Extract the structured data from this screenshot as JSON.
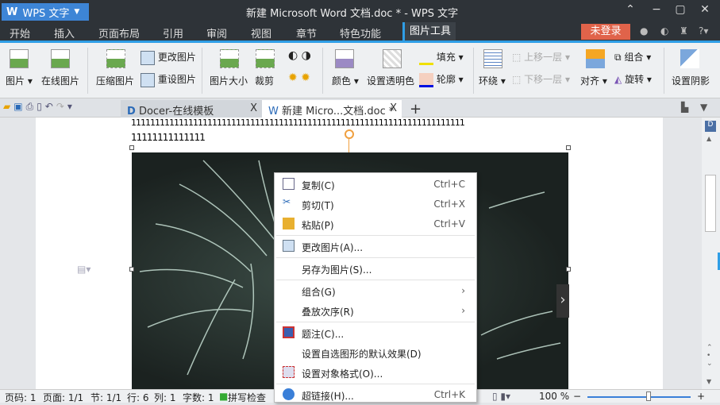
{
  "app": {
    "name": "WPS 文字",
    "title": "新建 Microsoft Word 文档.doc * - WPS 文字"
  },
  "tabs": [
    "开始",
    "插入",
    "页面布局",
    "引用",
    "审阅",
    "视图",
    "章节",
    "特色功能",
    "图片工具"
  ],
  "login": "未登录",
  "help": "?",
  "ribbon": {
    "picture": "图片",
    "online_picture": "在线图片",
    "compress": "压缩图片",
    "change": "更改图片",
    "reset": "重设图片",
    "size": "图片大小",
    "crop": "裁剪",
    "color": "颜色",
    "transparent": "设置透明色",
    "fill": "填充",
    "outline": "轮廓",
    "wrap": "环绕",
    "bring_forward": "上移一层",
    "send_backward": "下移一层",
    "align": "对齐",
    "group": "组合",
    "rotate": "旋转",
    "shadow": "设置阴影"
  },
  "doc_tabs": [
    {
      "label": "Docer-在线模板",
      "close": "X"
    },
    {
      "label": "新建 Micro...文档.doc *",
      "close": "X"
    }
  ],
  "new_tab": "+",
  "doc": {
    "line1": "1111111111111111111111111111111111111111111111111111111111111111111111",
    "line2": "11111111111111"
  },
  "context_menu": [
    {
      "label": "复制(C)",
      "shortcut": "Ctrl+C",
      "icon": "copy-icon"
    },
    {
      "label": "剪切(T)",
      "shortcut": "Ctrl+X",
      "icon": "scissors-icon"
    },
    {
      "label": "粘贴(P)",
      "shortcut": "Ctrl+V",
      "icon": "paste-icon"
    },
    {
      "label": "更改图片(A)...",
      "icon": "change-picture-icon"
    },
    {
      "label": "另存为图片(S)..."
    },
    {
      "label": "组合(G)",
      "submenu": "›"
    },
    {
      "label": "叠放次序(R)",
      "submenu": "›"
    },
    {
      "label": "题注(C)...",
      "icon": "caption-icon"
    },
    {
      "label": "设置自选图形的默认效果(D)"
    },
    {
      "label": "设置对象格式(O)...",
      "icon": "format-object-icon"
    },
    {
      "label": "超链接(H)...",
      "shortcut": "Ctrl+K",
      "icon": "hyperlink-icon"
    }
  ],
  "status": {
    "page_num": "页码: 1",
    "pages": "页面: 1/1",
    "section": "节: 1/1",
    "row": "行: 6",
    "col": "列: 1",
    "words": "字数: 1",
    "spell": "拼写检查",
    "zoom": "100 %",
    "zoom_minus": "−",
    "zoom_plus": "+"
  },
  "zoom_level": 100
}
